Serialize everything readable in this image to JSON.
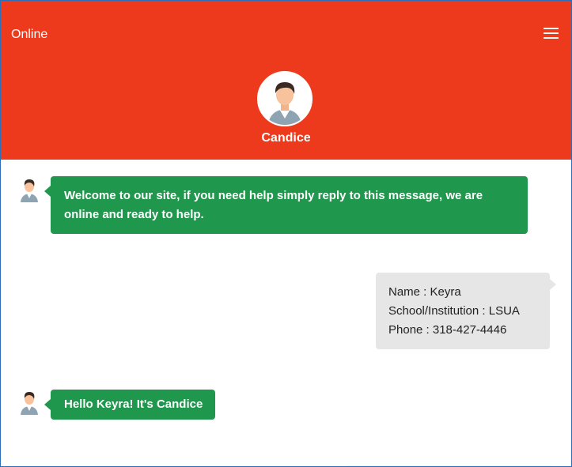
{
  "header": {
    "status": "Online",
    "agent_name": "Candice",
    "accent_color": "#ee3a1c",
    "menu_icon": "hamburger-menu-icon",
    "avatar_icon": "agent-avatar-icon"
  },
  "messages": [
    {
      "sender": "agent",
      "lines": [
        "Welcome to our site, if you need help simply reply to this message, we are",
        "online and ready to help."
      ]
    },
    {
      "sender": "user",
      "lines": [
        "Name : Keyra",
        "School/Institution : LSUA",
        "Phone : 318-427-4446"
      ]
    },
    {
      "sender": "agent",
      "lines": [
        "Hello Keyra! It's Candice"
      ]
    }
  ],
  "colors": {
    "agent_bubble": "#1f974c",
    "user_bubble": "#e6e6e6"
  }
}
